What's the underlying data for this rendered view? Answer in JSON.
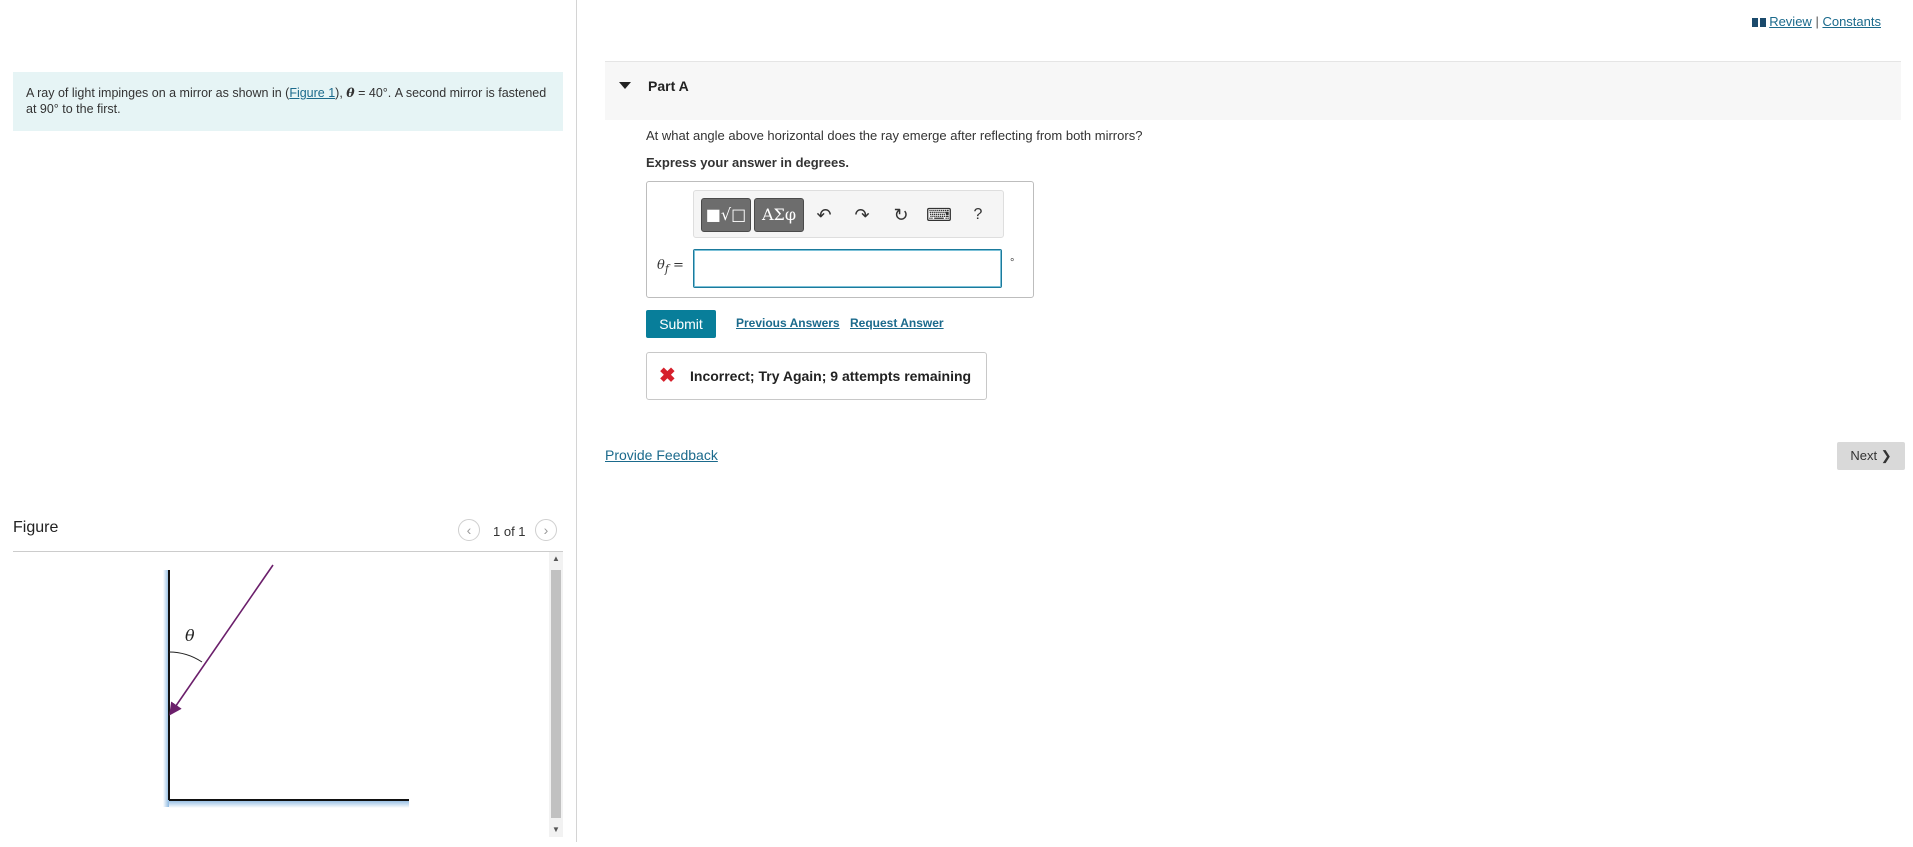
{
  "problem": {
    "text_before_link": "A ray of light impinges on a mirror as shown in (",
    "figure_link": "Figure 1",
    "text_after_link": "), ",
    "theta_symbol": "θ",
    "angle_text": " = 40°. A second mirror is fastened at 90° to the first."
  },
  "figure": {
    "title": "Figure",
    "counter": "1 of 1",
    "prev_icon": "chevron-left-icon",
    "next_icon": "chevron-right-icon",
    "angle_label": "θ",
    "ray_color": "#6b1f6b"
  },
  "header_links": {
    "review": "Review",
    "separator": "|",
    "constants": "Constants"
  },
  "part": {
    "title": "Part A",
    "question": "At what angle above horizontal does the ray emerge after reflecting from both mirrors?",
    "instruction": "Express your answer in degrees."
  },
  "toolbar": {
    "templates_label": "■√□",
    "greek_label": "ΑΣφ",
    "undo_icon": "↶",
    "redo_icon": "↷",
    "reset_icon": "↻",
    "keyboard_icon": "⌨",
    "help_label": "?"
  },
  "answer": {
    "var_symbol": "θ",
    "var_subscript": "f",
    "equals": "=",
    "value": "",
    "unit": "°"
  },
  "actions": {
    "submit": "Submit",
    "previous_answers": "Previous Answers",
    "request_answer": "Request Answer"
  },
  "feedback": {
    "icon": "✖",
    "message": "Incorrect; Try Again; 9 attempts remaining"
  },
  "footer": {
    "provide_feedback": "Provide Feedback",
    "next": "Next",
    "next_icon": "❯"
  },
  "colors": {
    "accent": "#087e9a",
    "link": "#1b6a8c",
    "error": "#d6202c",
    "problem_bg": "#e6f4f5"
  }
}
